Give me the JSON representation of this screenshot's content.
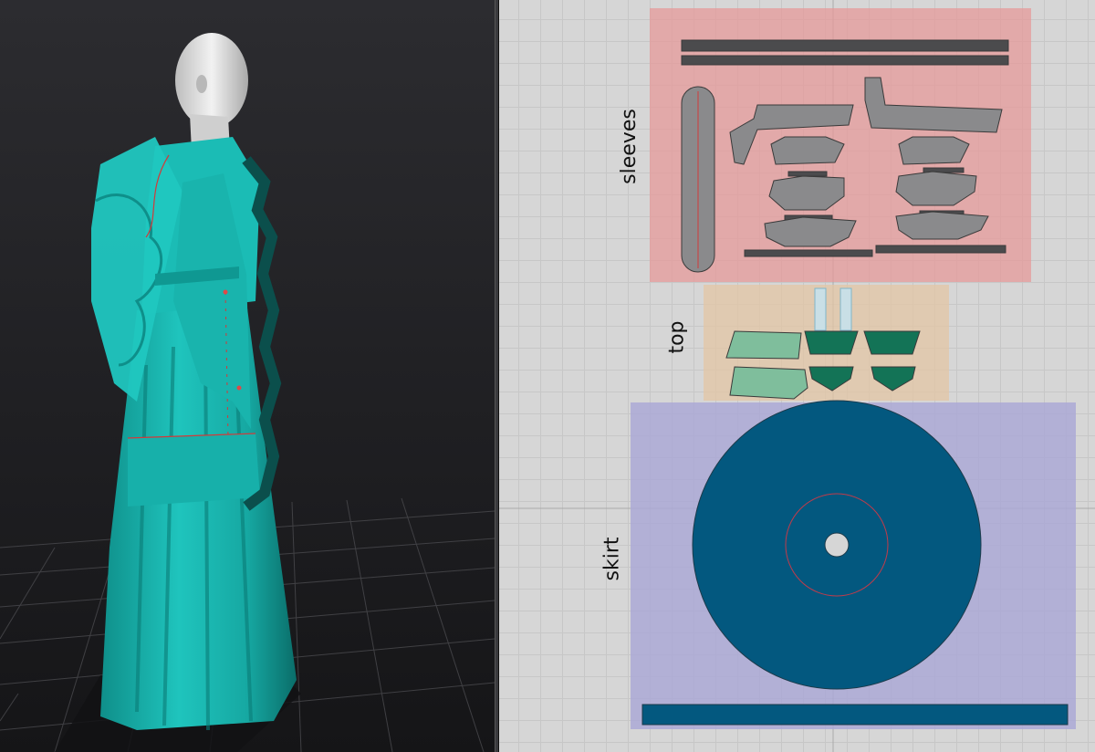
{
  "pattern_groups": {
    "sleeves": {
      "label": "sleeves",
      "color": "#e59a9a"
    },
    "top": {
      "label": "top",
      "color": "#e3c6a4"
    },
    "skirt": {
      "label": "skirt",
      "color": "#a9a6d6"
    }
  },
  "colors": {
    "garment_teal": "#18b3ad",
    "panel_gray": "#8a8a8c",
    "top_light": "#7fbe9c",
    "top_dark": "#137356",
    "skirt_blue": "#03587f",
    "seam_red": "#d23a3a",
    "viewport_bg": "#1e1e21"
  }
}
